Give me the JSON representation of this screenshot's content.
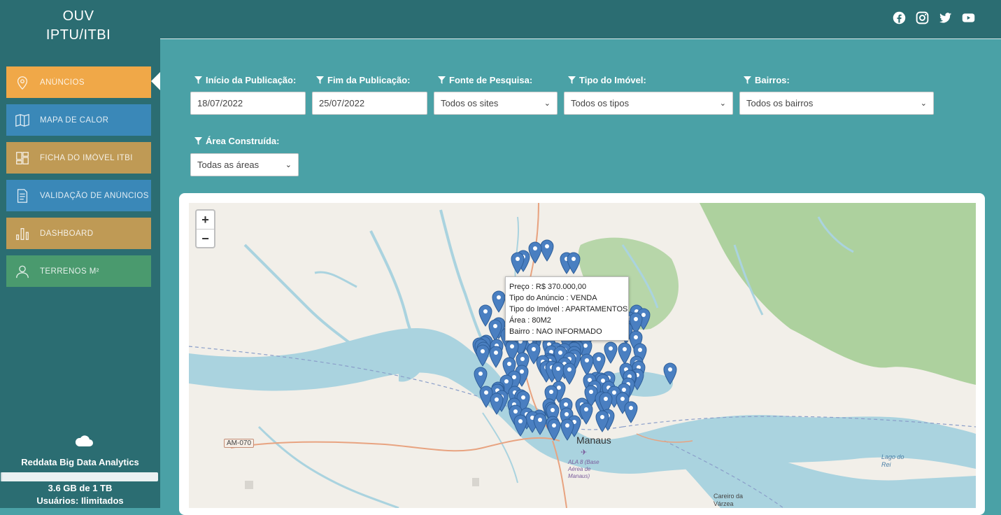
{
  "brand": {
    "line1": "OUV",
    "line2": "IPTU/ITBI"
  },
  "sidebar": {
    "items": [
      {
        "label": "ANÚNCIOS",
        "icon": "map-pin-icon",
        "color": "#f0a848",
        "active": true
      },
      {
        "label": "MAPA DE CALOR",
        "icon": "map-icon",
        "color": "#3a88b8"
      },
      {
        "label": "FICHA DO IMÓVEL ITBI",
        "icon": "layout-icon",
        "color": "#bf9a55"
      },
      {
        "label": "VALIDAÇÃO DE ANÚNCIOS",
        "icon": "document-icon",
        "color": "#3a88b8"
      },
      {
        "label": "DASHBOARD",
        "icon": "bar-chart-icon",
        "color": "#bf9a55"
      },
      {
        "label": "TERRENOS M²",
        "icon": "user-icon",
        "color": "#4a9a6e"
      }
    ],
    "storage": {
      "company": "Reddata Big Data Analytics",
      "usage": "3.6 GB de 1 TB",
      "users": "Usuários: Ilimitados",
      "fill_fraction": 0.0036
    }
  },
  "header": {
    "social": [
      "facebook-icon",
      "instagram-icon",
      "twitter-icon",
      "youtube-icon"
    ]
  },
  "filters": {
    "inicio": {
      "label": "Início da Publicação:",
      "value": "18/07/2022"
    },
    "fim": {
      "label": "Fim da Publicação:",
      "value": "25/07/2022"
    },
    "fonte": {
      "label": "Fonte de Pesquisa:",
      "value": "Todos os sites"
    },
    "tipo": {
      "label": "Tipo do Imóvel:",
      "value": "Todos os tipos"
    },
    "bairros": {
      "label": "Bairros:",
      "value": "Todos os bairros"
    },
    "area": {
      "label": "Área Construída:",
      "value": "Todas as áreas"
    }
  },
  "map": {
    "zoom_in": "+",
    "zoom_out": "−",
    "popup": {
      "preco": "Preço : R$ 370.000,00",
      "tipo_anuncio": "Tipo do Anúncio : VENDA",
      "tipo_imovel": "Tipo do Imóvel : APARTAMENTOS",
      "area": "Área : 80M2",
      "bairro": "Bairro : NAO INFORMADO"
    },
    "labels": {
      "road": "AM-070",
      "city": "Manaus",
      "base": "ALA 8 (Base Aérea de Manaus)",
      "lago": "Lago do Rei",
      "careiro": "Careiro da Várzea"
    },
    "colors": {
      "water": "#aad3df",
      "forest": "#add19e",
      "land": "#f2efe9",
      "marker": "#4a7fc1"
    }
  }
}
